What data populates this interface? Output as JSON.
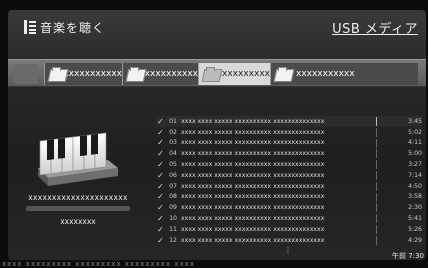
{
  "header": {
    "title": "音楽を聴く",
    "source": "USB メディア",
    "icon": "music-list-icon"
  },
  "folders": [
    {
      "label": "xxxxxxxxxxx",
      "active": false
    },
    {
      "label": "xxxxxxxxxxx",
      "active": false
    },
    {
      "label": "xxxxxxxxxx",
      "active": true
    },
    {
      "label": "xxxxxxxxxxx",
      "active": false
    }
  ],
  "album": {
    "title": "xxxxxxxxxxxxxxxxxxxxx",
    "artist": "xxxxxxxx",
    "art_icon": "piano-keyboard-icon"
  },
  "tracks": [
    {
      "num": "01",
      "name": "xxxx xxxx xxxxx xxxxxxxxxx xxxxxxxxxxxxxx",
      "dur": "3:45"
    },
    {
      "num": "02",
      "name": "xxxx xxxx xxxxx xxxxxxxxxx xxxxxxxxxxxxxx",
      "dur": "5:02"
    },
    {
      "num": "03",
      "name": "xxxx xxxx xxxxx xxxxxxxxxx xxxxxxxxxxxxxx",
      "dur": "4:11"
    },
    {
      "num": "04",
      "name": "xxxx xxxx xxxxx xxxxxxxxxx xxxxxxxxxxxxxx",
      "dur": "5:00"
    },
    {
      "num": "05",
      "name": "xxxx xxxx xxxxx xxxxxxxxxx xxxxxxxxxxxxxx",
      "dur": "3:27"
    },
    {
      "num": "06",
      "name": "xxxx xxxx xxxxx xxxxxxxxxx xxxxxxxxxxxxxx",
      "dur": "7:14"
    },
    {
      "num": "07",
      "name": "xxxx xxxx xxxxx xxxxxxxxxx xxxxxxxxxxxxxx",
      "dur": "4:50"
    },
    {
      "num": "08",
      "name": "xxxx xxxx xxxxx xxxxxxxxxx xxxxxxxxxxxxxx",
      "dur": "3:58"
    },
    {
      "num": "09",
      "name": "xxxx xxxx xxxxx xxxxxxxxxx xxxxxxxxxxxxxx",
      "dur": "2:30"
    },
    {
      "num": "10",
      "name": "xxxx xxxx xxxxx xxxxxxxxxx xxxxxxxxxxxxxx",
      "dur": "5:41"
    },
    {
      "num": "11",
      "name": "xxxx xxxx xxxxx xxxxxxxxxx xxxxxxxxxxxxxx",
      "dur": "5:26"
    },
    {
      "num": "12",
      "name": "xxxx xxxx xxxxx xxxxxxxxxx xxxxxxxxxxxxxx",
      "dur": "4:29"
    }
  ],
  "status": {
    "clock": "午前 7:30",
    "more_indicator": "⋮"
  },
  "bottom_strip": "xxxx  xxxxxxxxx  xxxxxxxxx  xxxxxxxxx  xxxx",
  "colors": {
    "active_tab": "#d9d9d9",
    "background": "#1f1f1f",
    "folder_bar": "#6b6b6b"
  }
}
